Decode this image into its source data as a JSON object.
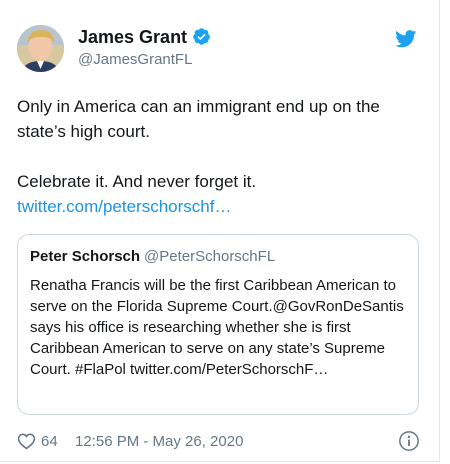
{
  "author": {
    "name": "James Grant",
    "handle": "@JamesGrantFL",
    "verified": true
  },
  "tweet": {
    "line1": "Only in America can an immigrant end up on the state’s high court.",
    "line2": "Celebrate it. And never forget it.",
    "link": "twitter.com/peterschorschf…"
  },
  "quoted": {
    "name": "Peter Schorsch",
    "handle": "@PeterSchorschFL",
    "text": "Renatha Francis will be the first Caribbean American to serve on the Florida Supreme Court.@GovRonDeSantis says his office is researching whether she is first Caribbean American to serve on any state’s Supreme Court. #FlaPol twitter.com/PeterSchorschF…"
  },
  "footer": {
    "likes": "64",
    "timestamp": "12:56 PM - May 26, 2020"
  },
  "icons": {
    "verified": "verified-badge-icon",
    "twitter": "twitter-bird-icon",
    "like": "heart-icon",
    "info": "info-icon"
  },
  "colors": {
    "link": "#1b95e0",
    "secondary_text": "#657786",
    "border": "#ccd6dd"
  }
}
